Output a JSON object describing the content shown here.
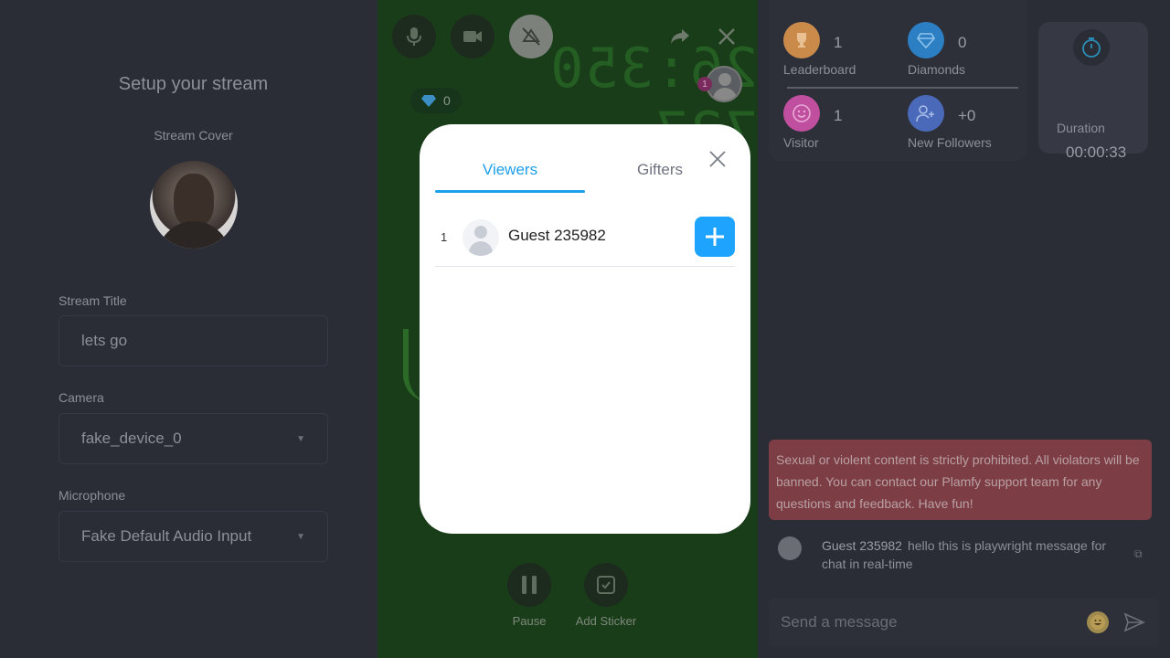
{
  "setup": {
    "title": "Setup your stream",
    "cover_label": "Stream Cover",
    "stream_title_label": "Stream Title",
    "stream_title_value": "lets go",
    "camera_label": "Camera",
    "camera_value": "fake_device_0",
    "microphone_label": "Microphone",
    "microphone_value": "Fake Default Audio Input"
  },
  "stream": {
    "diamonds": "0",
    "viewer_badge_count": "1",
    "pause_label": "Pause",
    "add_sticker_label": "Add Sticker",
    "background_text": "26:350 727"
  },
  "modal": {
    "tabs": [
      {
        "label": "Viewers"
      },
      {
        "label": "Gifters"
      }
    ],
    "viewers": [
      {
        "rank": "1",
        "name": "Guest 235982"
      }
    ]
  },
  "stats": {
    "leaderboard_value": "1",
    "leaderboard_label": "Leaderboard",
    "diamonds_value": "0",
    "diamonds_label": "Diamonds",
    "visitor_value": "1",
    "visitor_label": "Visitor",
    "followers_value": "+0",
    "followers_label": "New Followers",
    "duration_label": "Duration",
    "duration_value": "00:00:33"
  },
  "chat": {
    "warning": "Sexual or violent content is strictly prohibited. All violators will be banned. You can contact our Plamfy support team for any questions and feedback. Have fun!",
    "messages": [
      {
        "author": "Guest 235982",
        "text": "hello this is playwright message for chat in real-time"
      }
    ],
    "input_placeholder": "Send a message"
  },
  "colors": {
    "accent": "#1e9fea",
    "add_button": "#1ea3ff",
    "warning_bg": "#7c3d44",
    "leaderboard_icon": "#c98a4a",
    "diamonds_icon": "#2c7fc2",
    "visitor_icon": "#c0509f",
    "followers_icon": "#4a69b8"
  },
  "icons": [
    "microphone-icon",
    "camera-icon",
    "effects-off-icon",
    "share-icon",
    "close-icon",
    "diamond-icon",
    "plus-icon",
    "pause-icon",
    "sticker-icon",
    "trophy-icon",
    "smile-icon",
    "user-add-icon",
    "timer-icon",
    "emoji-icon",
    "send-icon",
    "translate-icon"
  ]
}
